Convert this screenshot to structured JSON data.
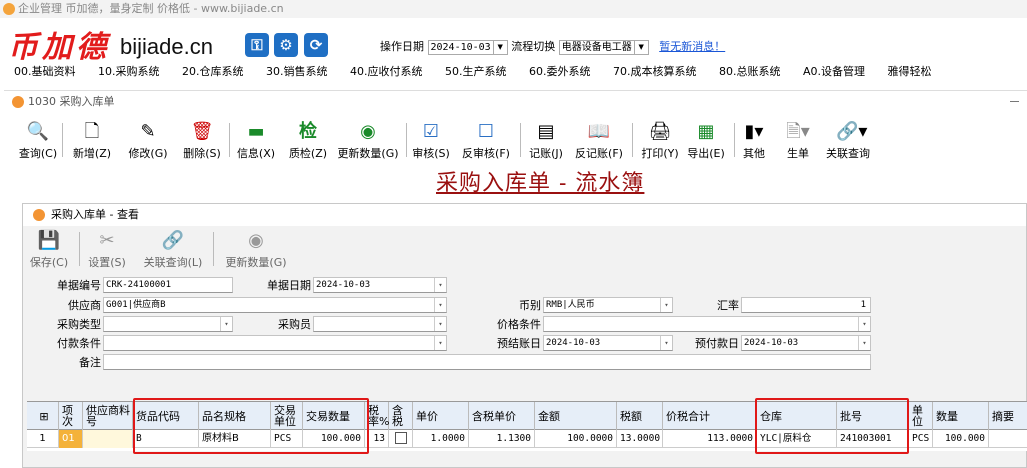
{
  "app": {
    "title": "企业管理 币加德，量身定制 价格低 - www.bijiade.cn",
    "logo_cn": "币加德",
    "logo_en": "bijiade.cn",
    "op_date_label": "操作日期",
    "op_date": "2024-10-03",
    "flow_label": "流程切换",
    "flow_value": "电器设备电工器",
    "new_msg": "暂无新消息！"
  },
  "menu": [
    "00.基础资料",
    "10.采购系统",
    "20.仓库系统",
    "30.销售系统",
    "40.应收付系统",
    "50.生产系统",
    "60.委外系统",
    "70.成本核算系统",
    "80.总账系统",
    "A0.设备管理",
    "雅得轻松"
  ],
  "window1": {
    "title": "1030 采购入库单",
    "toolbar": [
      "查询(C)",
      "新增(Z)",
      "修改(G)",
      "删除(S)",
      "信息(X)",
      "质检(Z)",
      "更新数量(G)",
      "审核(S)",
      "反审核(F)",
      "记账(J)",
      "反记账(F)",
      "打印(Y)",
      "导出(E)",
      "其他",
      "生单",
      "关联查询"
    ],
    "toolbar_icons": [
      "search-icon",
      "new-doc-icon",
      "edit-icon",
      "delete-icon",
      "info-icon",
      "inspect-icon",
      "update-qty-icon",
      "audit-icon",
      "unaudit-icon",
      "post-icon",
      "unpost-icon",
      "print-icon",
      "export-icon",
      "other-icon",
      "generate-icon",
      "link-query-icon"
    ],
    "big_title": "采购入库单 - 流水簿"
  },
  "window2": {
    "title": "采购入库单 - 查看",
    "toolbar": [
      "保存(C)",
      "设置(S)",
      "关联查询(L)",
      "更新数量(G)"
    ],
    "form": {
      "doc_no_label": "单据编号",
      "doc_no": "CRK-24100001",
      "doc_date_label": "单据日期",
      "doc_date": "2024-10-03",
      "supplier_label": "供应商",
      "supplier": "G001|供应商B",
      "currency_label": "币别",
      "currency": "RMB|人民币",
      "rate_label": "汇率",
      "rate": "1",
      "ptype_label": "采购类型",
      "ptype": "",
      "buyer_label": "采购员",
      "buyer": "",
      "price_label": "价格条件",
      "price": "",
      "pay_label": "付款条件",
      "pay": "",
      "settle_label": "预结账日",
      "settle": "2024-10-03",
      "prepay_label": "预付款日",
      "prepay": "2024-10-03",
      "remark_label": "备注",
      "remark": ""
    },
    "grid": {
      "headers": [
        "项次",
        "供应商料号",
        "货品代码",
        "品名规格",
        "交易单位",
        "交易数量",
        "税率%",
        "含税",
        "单价",
        "含税单价",
        "金额",
        "税额",
        "价税合计",
        "仓库",
        "批号",
        "单位",
        "数量",
        "摘要"
      ],
      "row": [
        "1",
        "01",
        "",
        "B",
        "原材料B",
        "PCS",
        "100.000",
        "13",
        "",
        "1.0000",
        "1.1300",
        "100.0000",
        "13.0000",
        "113.0000",
        "YLC|原料仓",
        "241003001",
        "PCS",
        "100.000",
        ""
      ]
    }
  }
}
